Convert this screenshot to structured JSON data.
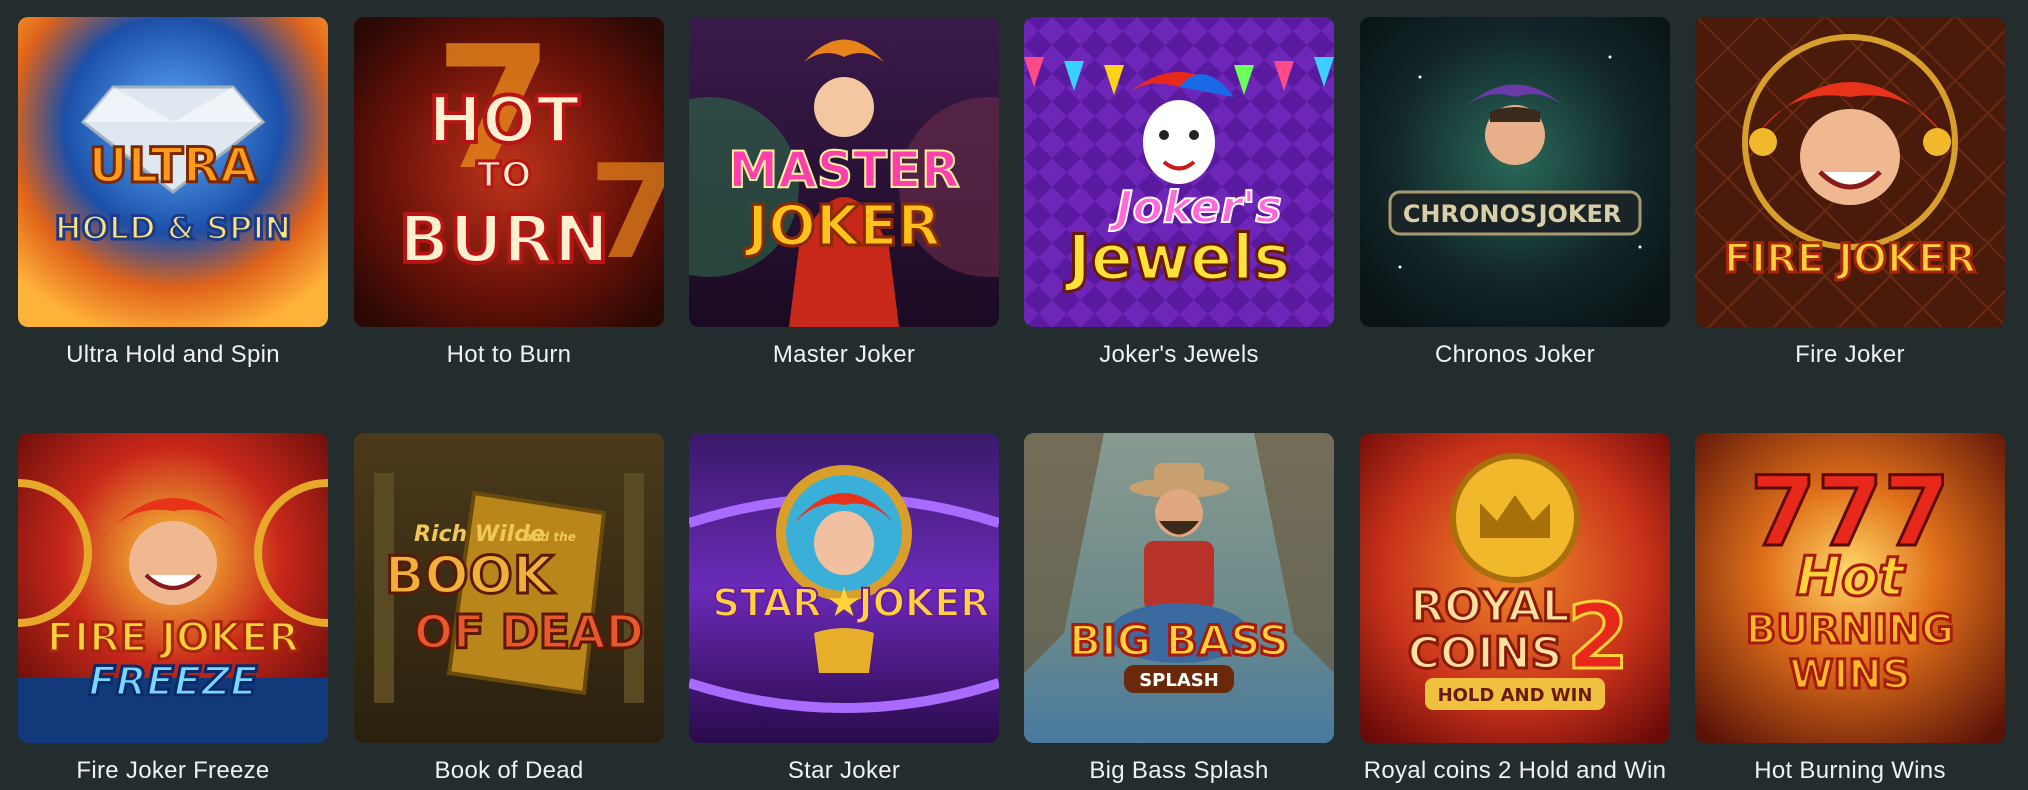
{
  "games": [
    {
      "title": "Ultra Hold and Spin",
      "logo": [
        "ULTRA",
        "HOLD & SPIN"
      ],
      "icon": "diamond-icon"
    },
    {
      "title": "Hot to Burn",
      "logo": [
        "HOT",
        "TO",
        "BURN"
      ],
      "icon": "seven-icon"
    },
    {
      "title": "Master Joker",
      "logo": [
        "MASTER",
        "JOKER"
      ],
      "icon": "jester-icon"
    },
    {
      "title": "Joker's Jewels",
      "logo": [
        "Joker's",
        "Jewels"
      ],
      "icon": "jester-mask-icon"
    },
    {
      "title": "Chronos Joker",
      "logo": [
        "CHRONOS",
        "JOKER"
      ],
      "icon": "jester-icon"
    },
    {
      "title": "Fire Joker",
      "logo": [
        "FIRE JOKER"
      ],
      "icon": "jester-icon"
    },
    {
      "title": "Fire Joker Freeze",
      "logo": [
        "FIRE JOKER",
        "FREEZE"
      ],
      "icon": "jester-icon"
    },
    {
      "title": "Book of Dead",
      "logo": [
        "Rich Wilde",
        "and the",
        "BOOK",
        "OF DEAD"
      ],
      "icon": "book-icon"
    },
    {
      "title": "Star Joker",
      "logo": [
        "STAR",
        "JOKER"
      ],
      "icon": "star-icon"
    },
    {
      "title": "Big Bass Splash",
      "logo": [
        "BIG BASS",
        "SPLASH"
      ],
      "icon": "fisherman-icon"
    },
    {
      "title": "Royal coins 2 Hold and Win",
      "logo": [
        "ROYAL",
        "COINS",
        "2",
        "HOLD AND WIN"
      ],
      "icon": "crown-coin-icon"
    },
    {
      "title": "Hot Burning Wins",
      "logo": [
        "777",
        "Hot",
        "BURNING",
        "WINS"
      ],
      "icon": "seven-icon"
    }
  ],
  "colors": {
    "background": "#232d2d",
    "title_text": "#eef2f2"
  }
}
